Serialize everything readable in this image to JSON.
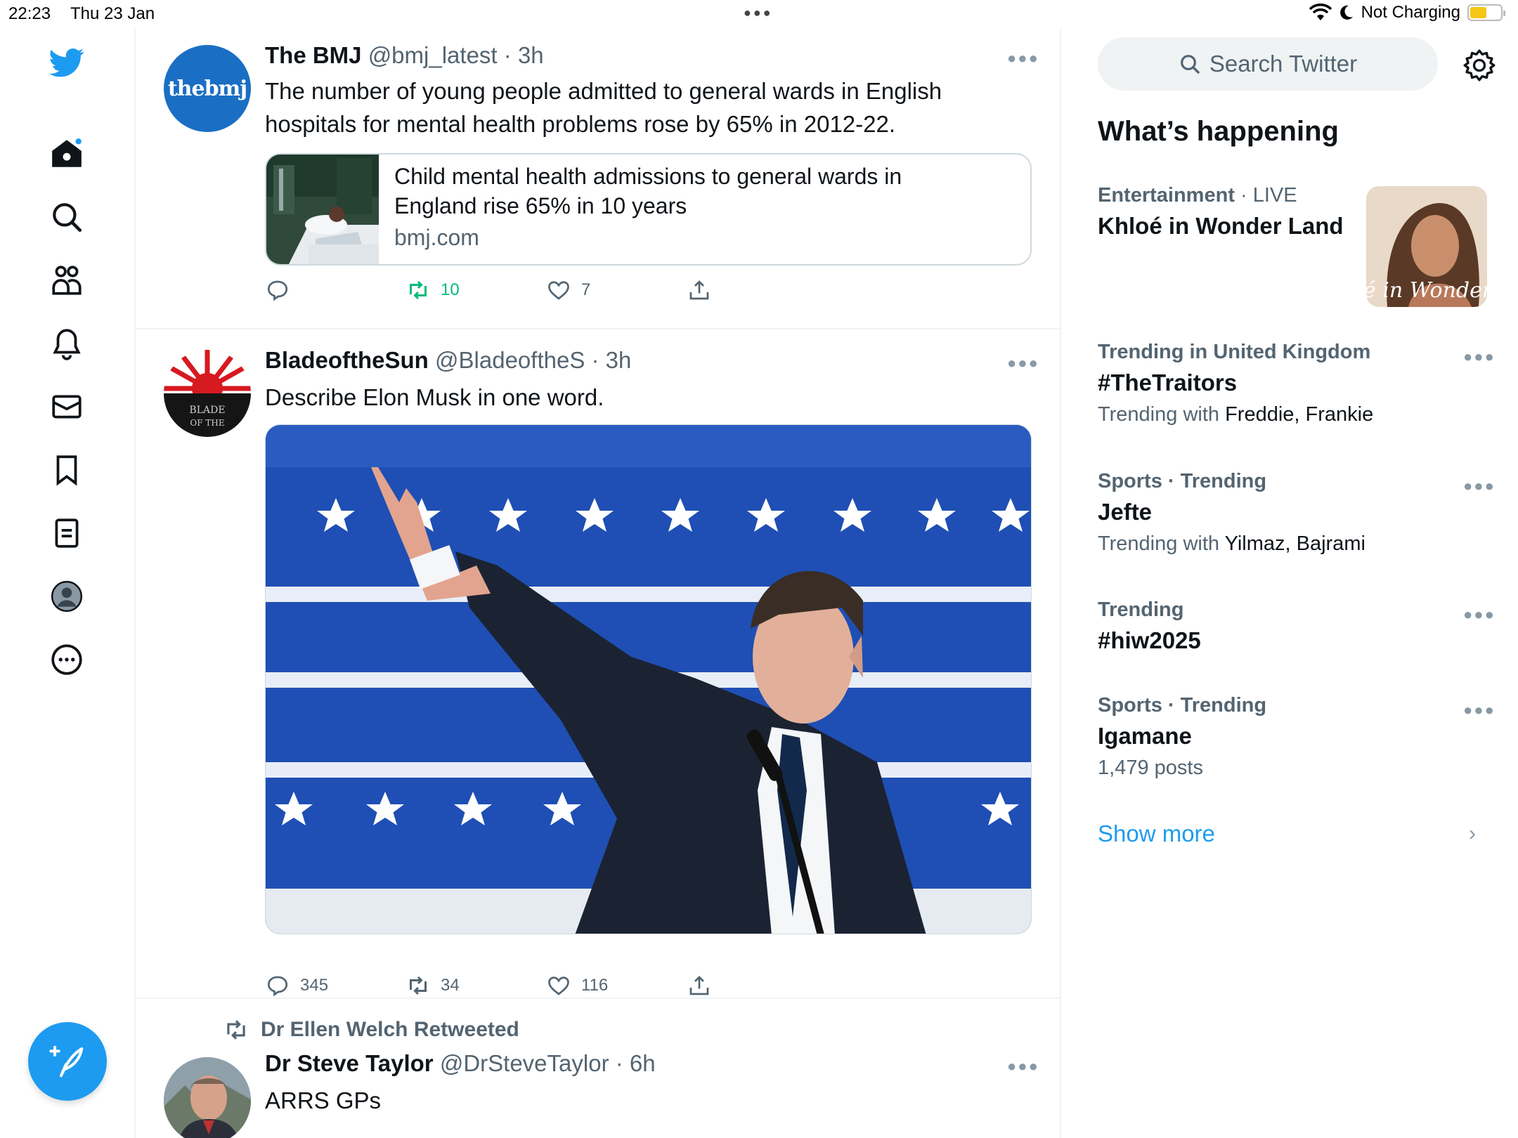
{
  "status_bar": {
    "time": "22:23",
    "date": "Thu 23 Jan",
    "charging": "Not Charging"
  },
  "nav": {
    "items": [
      "home-icon",
      "search-icon",
      "communities-icon",
      "notifications-icon",
      "messages-icon",
      "bookmarks-icon",
      "lists-icon",
      "profile-icon",
      "more-icon"
    ],
    "compose_icon": "feather-plus-icon"
  },
  "colors": {
    "accent": "#1d9bf0",
    "retweet_active": "#00ba7c",
    "muted": "#536471",
    "text": "#0f1419",
    "border": "#eff3f4"
  },
  "tweets": [
    {
      "name": "The BMJ",
      "handle": "@bmj_latest",
      "sep": "·",
      "time": "3h",
      "avatar_text": "thebmj",
      "text_lines": [
        "The number of young people admitted to general wards in English",
        "hospitals for mental health problems rose by 65% in 2012-22."
      ],
      "card": {
        "title_lines": [
          "Child mental health admissions to general wards in",
          "England rise 65% in 10 years"
        ],
        "domain": "bmj.com"
      },
      "actions": {
        "replies": "",
        "retweets": "10",
        "likes": "7"
      }
    },
    {
      "name": "BladeoftheSun",
      "handle": "@BladeoftheS",
      "sep": "·",
      "time": "3h",
      "avatar_text": "BLADE OF THE",
      "text_lines": [
        "Describe Elon Musk in one word."
      ],
      "actions": {
        "replies": "345",
        "retweets": "34",
        "likes": "116"
      }
    },
    {
      "retweeted_by": "Dr Ellen Welch Retweeted",
      "name": "Dr Steve Taylor",
      "handle": "@DrSteveTaylor",
      "sep": "·",
      "time": "6h",
      "text_lines": [
        "ARRS GPs"
      ]
    }
  ],
  "sidebar": {
    "search_placeholder": "Search Twitter",
    "heading": "What’s happening",
    "trends": [
      {
        "category": "Entertainment",
        "live": "· LIVE",
        "title": "Khloé in Wonder Land",
        "image_text": "é in Wonder L"
      },
      {
        "category": "Trending in United Kingdom",
        "title": "#TheTraitors",
        "sub_prefix": "Trending with",
        "sub_names": "Freddie, Frankie"
      },
      {
        "category": "Sports · Trending",
        "title": "Jefte",
        "sub_prefix": "Trending with",
        "sub_names": "Yilmaz, Bajrami"
      },
      {
        "category": "Trending",
        "title": "#hiw2025"
      },
      {
        "category": "Sports · Trending",
        "title": "Igamane",
        "sub_plain": "1,479 posts"
      }
    ],
    "show_more": "Show more"
  }
}
